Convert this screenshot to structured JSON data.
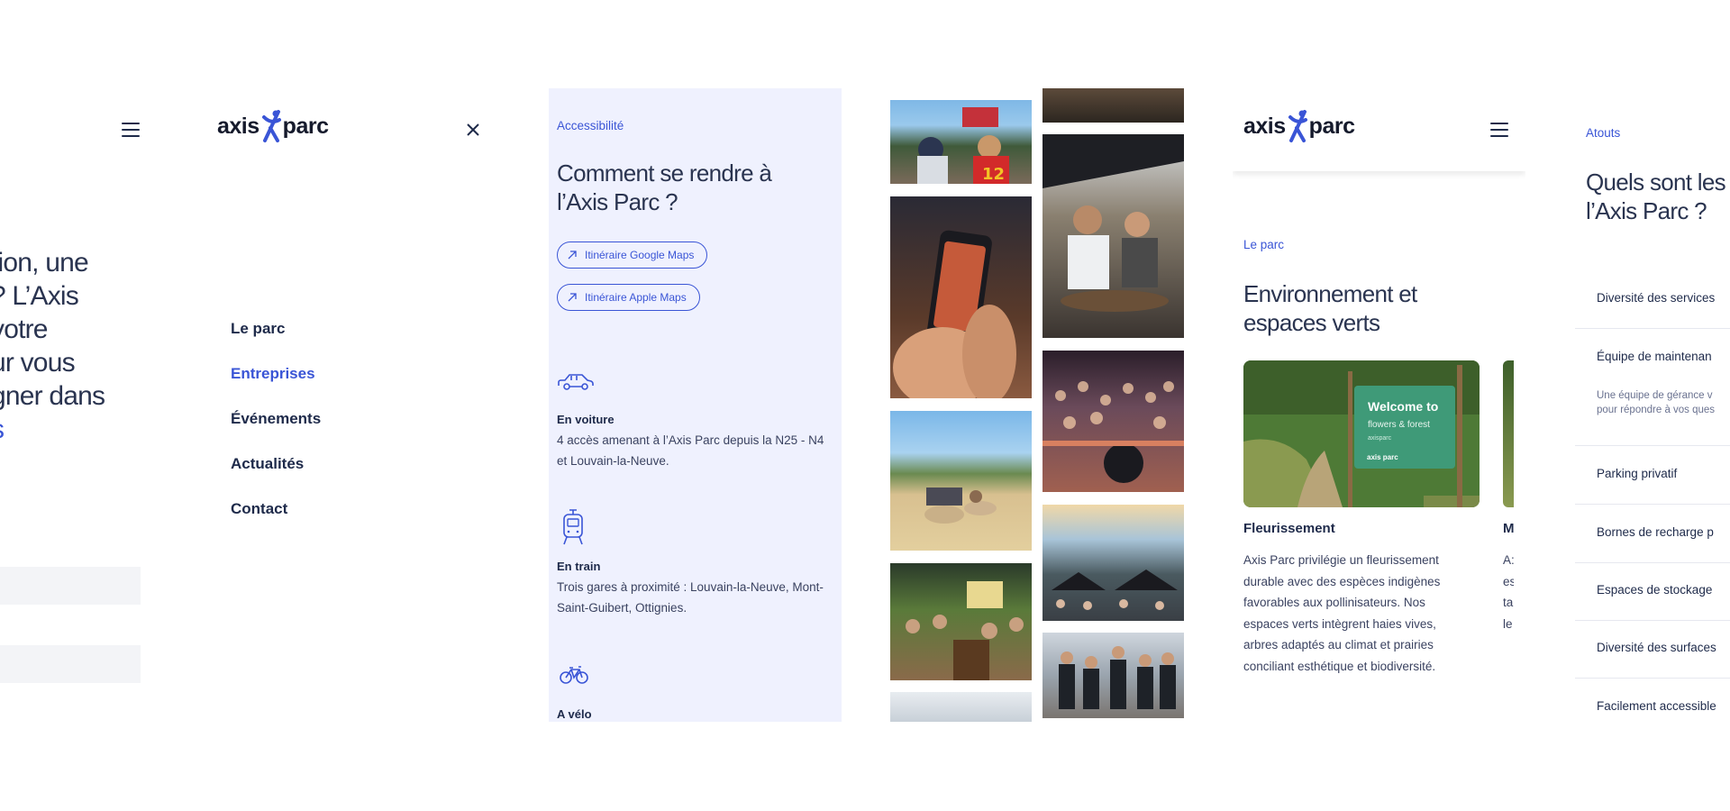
{
  "panel1": {
    "hero_lines": "tion, une\n? L’Axis\nvotre\nur vous\ngner dans",
    "hero_link": "s"
  },
  "panel2": {
    "logo": {
      "left": "axis",
      "right": "parc"
    },
    "menu": [
      {
        "label": "Le parc",
        "active": false
      },
      {
        "label": "Entreprises",
        "active": true
      },
      {
        "label": "Événements",
        "active": false
      },
      {
        "label": "Actualités",
        "active": false
      },
      {
        "label": "Contact",
        "active": false
      }
    ]
  },
  "panel3": {
    "eyebrow": "Accessibilité",
    "title": "Comment se rendre à l’Axis Parc ?",
    "buttons": {
      "google": "Itinéraire Google Maps",
      "apple": "Itinéraire Apple Maps"
    },
    "car": {
      "title": "En voiture",
      "text": "4 accès amenant à l’Axis Parc depuis la N25 - N4 et Louvain-la-Neuve."
    },
    "train": {
      "title": "En train",
      "text": "Trois gares à proximité : Louvain-la-Neuve, Mont-Saint-Guibert, Ottignies."
    },
    "bike": {
      "title": "A vélo"
    }
  },
  "panel5": {
    "logo": {
      "left": "axis",
      "right": "parc"
    },
    "eyebrow": "Le parc",
    "title": "Environnement et espaces verts",
    "card": {
      "title": "Fleurissement",
      "text": "Axis Parc privilégie un fleurissement durable avec des espèces indigènes favorables aux pollinisateurs. Nos espaces verts intègrent haies vives, arbres adaptés au climat et prairies conciliant esthétique et biodiversité.",
      "sign_line1": "Welcome to",
      "sign_line2": "flowers & forest",
      "sign_line3": "axisparc",
      "sign_logo": "axis parc"
    },
    "card2": {
      "title": "M",
      "text_fragments": [
        "A:",
        "es",
        "ta",
        "le"
      ]
    }
  },
  "panel6": {
    "eyebrow": "Atouts",
    "title": "Quels sont les\nl’Axis Parc ?",
    "rows": [
      "Diversité des services",
      "Équipe de maintenan",
      "Parking privatif",
      "Bornes de recharge p",
      "Espaces de stockage",
      "Diversité des surfaces",
      "Facilement accessible"
    ],
    "row2_desc": "Une équipe de gérance v\npour répondre à vos ques"
  },
  "colors": {
    "accent": "#3a55d6",
    "text": "#1e2a4a",
    "panel_bg": "#eff1fe",
    "gray_field": "#f3f4f7"
  }
}
